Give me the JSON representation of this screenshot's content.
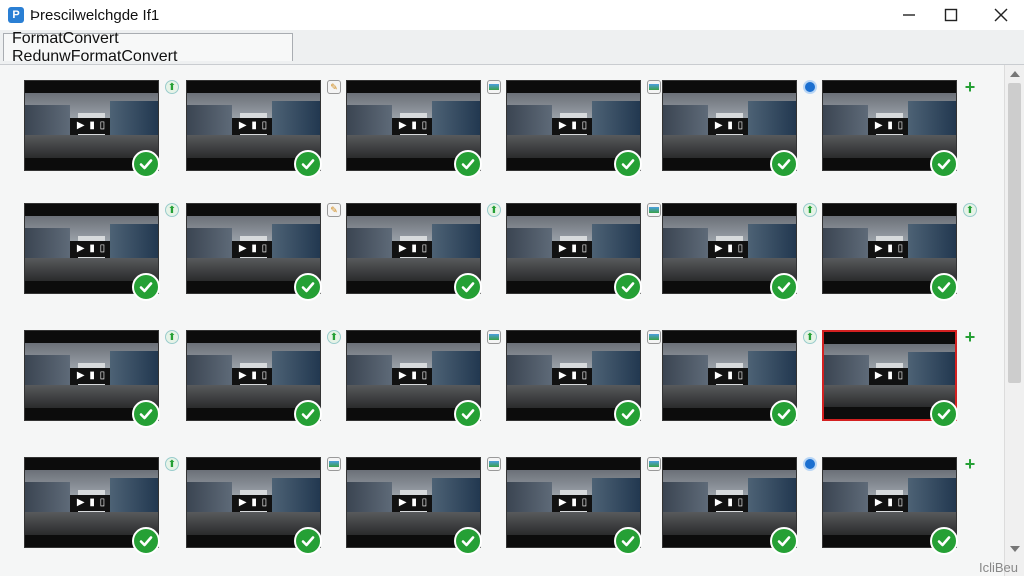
{
  "window": {
    "title": "Þrescilwelchgde If1",
    "minimize_icon": "minimize-icon",
    "maximize_icon": "maximize-icon",
    "close_icon": "close-icon"
  },
  "tabs": [
    {
      "label": "FormatConvert RedunwFormatConvert",
      "active": true
    }
  ],
  "thumbnail": {
    "play_label": "▶ ▮ ▯",
    "status_icon": "check-circle-icon",
    "check_color": "#25a035"
  },
  "grid": {
    "columns": 6,
    "rows": 4,
    "badges": [
      [
        "arrow",
        "pencil",
        "img",
        "img",
        "orb",
        "plus"
      ],
      [
        "arrow",
        "pencil",
        "arrow",
        "img",
        "arrow",
        "arrow"
      ],
      [
        "arrow",
        "arrow",
        "img",
        "img",
        "arrow",
        "plus"
      ],
      [
        "arrow",
        "img",
        "img",
        "img",
        "orb",
        "plus"
      ]
    ],
    "selected": {
      "row": 2,
      "col": 5
    }
  },
  "status": {
    "text": "IcliBeu"
  },
  "colors": {
    "accent": "#2a7fd4",
    "selected_border": "#d42020"
  }
}
